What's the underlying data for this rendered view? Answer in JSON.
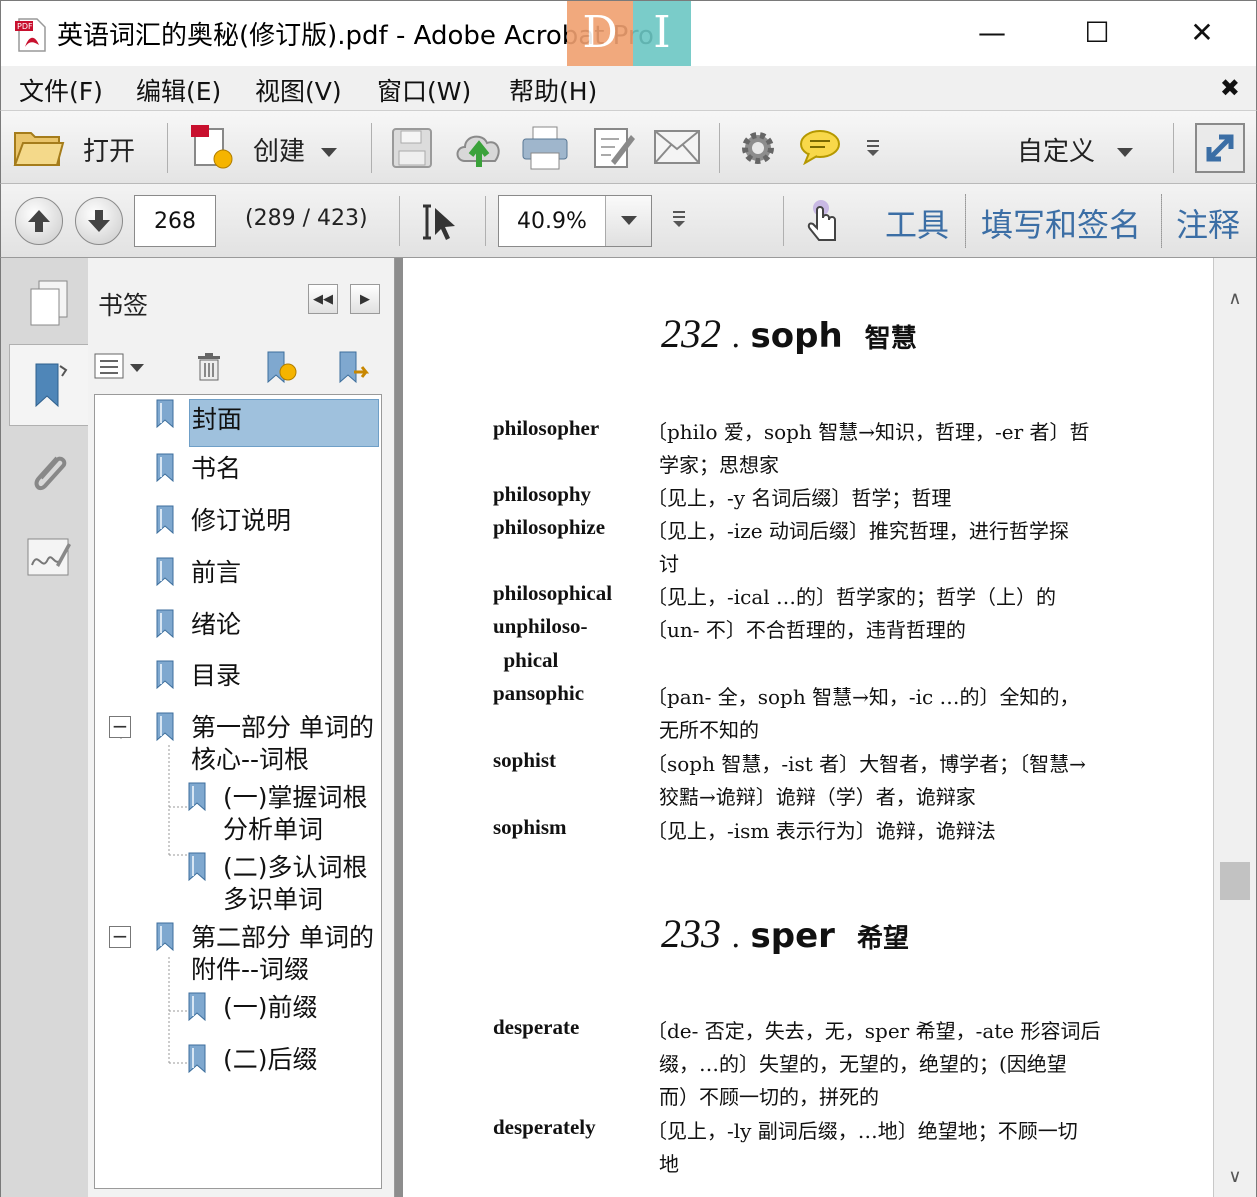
{
  "window": {
    "title": "英语词汇的奥秘(修订版).pdf - Adobe Acrobat Pro",
    "watermark_left": "D",
    "watermark_right": "I",
    "minimize": "—",
    "maximize": "☐",
    "close": "✕"
  },
  "menu": {
    "items": [
      "文件(F)",
      "编辑(E)",
      "视图(V)",
      "窗口(W)",
      "帮助(H)"
    ],
    "close_symbol": "✖"
  },
  "toolbar": {
    "open_label": "打开",
    "create_label": "创建",
    "customize_label": "自定义",
    "icons": [
      "open-folder-icon",
      "create-pdf-icon",
      "save-icon",
      "cloud-upload-icon",
      "print-icon",
      "edit-icon",
      "email-icon",
      "gear-icon",
      "comment-icon",
      "overflow-icon",
      "fullscreen-icon"
    ]
  },
  "navigation": {
    "page_number": "268",
    "page_count": "(289 / 423)",
    "zoom": "40.9%",
    "tools_label": "工具",
    "sign_label": "填写和签名",
    "comment_label": "注释"
  },
  "bookmarks": {
    "title": "书签",
    "items": [
      {
        "label": "封面",
        "selected": true
      },
      {
        "label": "书名"
      },
      {
        "label": "修订说明"
      },
      {
        "label": "前言"
      },
      {
        "label": "绪论"
      },
      {
        "label": "目录"
      },
      {
        "label_lines": [
          "第一部分 单词的",
          "核心--词根"
        ],
        "expanded": true
      },
      {
        "label_lines": [
          "(一)掌握词根",
          "分析单词"
        ]
      },
      {
        "label_lines": [
          "(二)多认词根",
          "多识单词"
        ]
      },
      {
        "label_lines": [
          "第二部分 单词的",
          "附件--词缀"
        ],
        "expanded": true
      },
      {
        "label": "(一)前缀"
      },
      {
        "label": "(二)后缀"
      }
    ],
    "expander_symbol": "−"
  },
  "document": {
    "sections": [
      {
        "number": "232",
        "dot": ".",
        "root": "soph",
        "meaning": "智慧",
        "entries": [
          {
            "word": "philosopher",
            "def": [
              "〔philo 爱，soph 智慧→知识，哲理，-er 者〕哲",
              "学家；思想家"
            ]
          },
          {
            "word": "philosophy",
            "def": [
              "〔见上，-y 名词后缀〕哲学；哲理"
            ]
          },
          {
            "word": "philosophize",
            "def": [
              "〔见上，-ize 动词后缀〕推究哲理，进行哲学探",
              "讨"
            ]
          },
          {
            "word": "philosophical",
            "def": [
              "〔见上，-ical …的〕哲学家的；哲学（上）的"
            ]
          },
          {
            "word": "unphiloso-",
            "word2": "  phical",
            "def": [
              "〔un- 不〕不合哲理的，违背哲理的"
            ]
          },
          {
            "word": "pansophic",
            "def": [
              "〔pan- 全，soph 智慧→知，-ic …的〕全知的，",
              "无所不知的"
            ]
          },
          {
            "word": "sophist",
            "def": [
              "〔soph 智慧，-ist 者〕大智者，博学者；〔智慧→",
              "狡黠→诡辩〕诡辩（学）者，诡辩家"
            ]
          },
          {
            "word": "sophism",
            "def": [
              "〔见上，-ism 表示行为〕诡辩，诡辩法"
            ]
          }
        ]
      },
      {
        "number": "233",
        "dot": ".",
        "root": "sper",
        "meaning": "希望",
        "entries": [
          {
            "word": "desperate",
            "def": [
              "〔de- 否定，失去，无，sper 希望，-ate 形容词后",
              "缀，…的〕失望的，无望的，绝望的；(因绝望",
              "而）不顾一切的，拼死的"
            ]
          },
          {
            "word": "desperately",
            "def": [
              "〔见上，-ly 副词后缀，…地〕绝望地；不顾一切",
              "地"
            ]
          }
        ]
      }
    ]
  },
  "scrollbar": {
    "up": "∧",
    "down": "∨",
    "position": 0.68
  }
}
